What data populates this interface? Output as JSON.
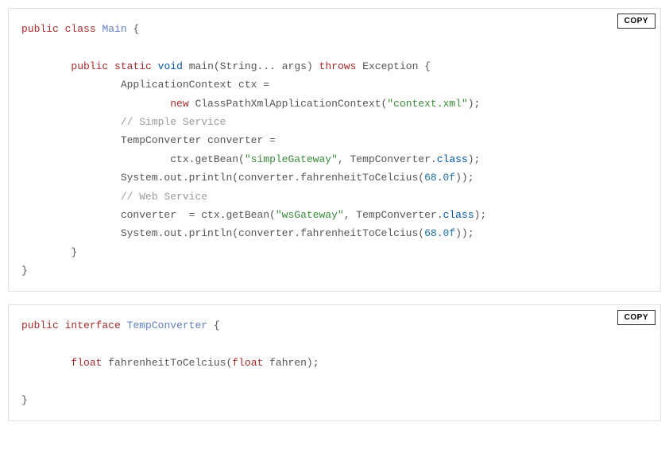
{
  "buttons": {
    "copy": "COPY"
  },
  "block1": {
    "l0_public": "public",
    "l0_class": "class",
    "l0_name": "Main",
    "l0_brace": " {",
    "l2_indent": "        ",
    "l2_public": "public",
    "l2_sp1": " ",
    "l2_static": "static",
    "l2_sp2": " ",
    "l2_void": "void",
    "l2_sp3": " ",
    "l2_main": "main",
    "l2_args": "(String... args) ",
    "l2_throws": "throws",
    "l2_exc": " Exception {",
    "l3_indent": "                ",
    "l3_txt": "ApplicationContext ctx =",
    "l4_indent": "                        ",
    "l4_new": "new",
    "l4_sp": " ",
    "l4_ctor": "ClassPathXmlApplicationContext(",
    "l4_str": "\"context.xml\"",
    "l4_end": ");",
    "l5_indent": "                ",
    "l5_cmt": "// Simple Service",
    "l6_indent": "                ",
    "l6_txt": "TempConverter converter =",
    "l7_indent": "                        ",
    "l7_a": "ctx.getBean(",
    "l7_str": "\"simpleGateway\"",
    "l7_comma": ", TempConverter.",
    "l7_class": "class",
    "l7_end": ");",
    "l8_indent": "                ",
    "l8_a": "System.out.println(converter.fahrenheitToCelcius(",
    "l8_num": "68.0f",
    "l8_end": "));",
    "l9_indent": "                ",
    "l9_cmt": "// Web Service",
    "l10_indent": "                ",
    "l10_a": "converter  = ctx.getBean(",
    "l10_str": "\"wsGateway\"",
    "l10_comma": ", TempConverter.",
    "l10_class": "class",
    "l10_end": ");",
    "l11_indent": "                ",
    "l11_a": "System.out.println(converter.fahrenheitToCelcius(",
    "l11_num": "68.0f",
    "l11_end": "));",
    "l12_indent": "        ",
    "l12_brace": "}",
    "l13_brace": "}"
  },
  "block2": {
    "l0_public": "public",
    "l0_sp": " ",
    "l0_iface": "interface",
    "l0_sp2": " ",
    "l0_name": "TempConverter",
    "l0_brace": " {",
    "l2_indent": "        ",
    "l2_float1": "float",
    "l2_sp1": " ",
    "l2_method": "fahrenheitToCelcius",
    "l2_open": "(",
    "l2_float2": "float",
    "l2_sp2": " ",
    "l2_param": "fahren);",
    "l4_brace": "}"
  }
}
